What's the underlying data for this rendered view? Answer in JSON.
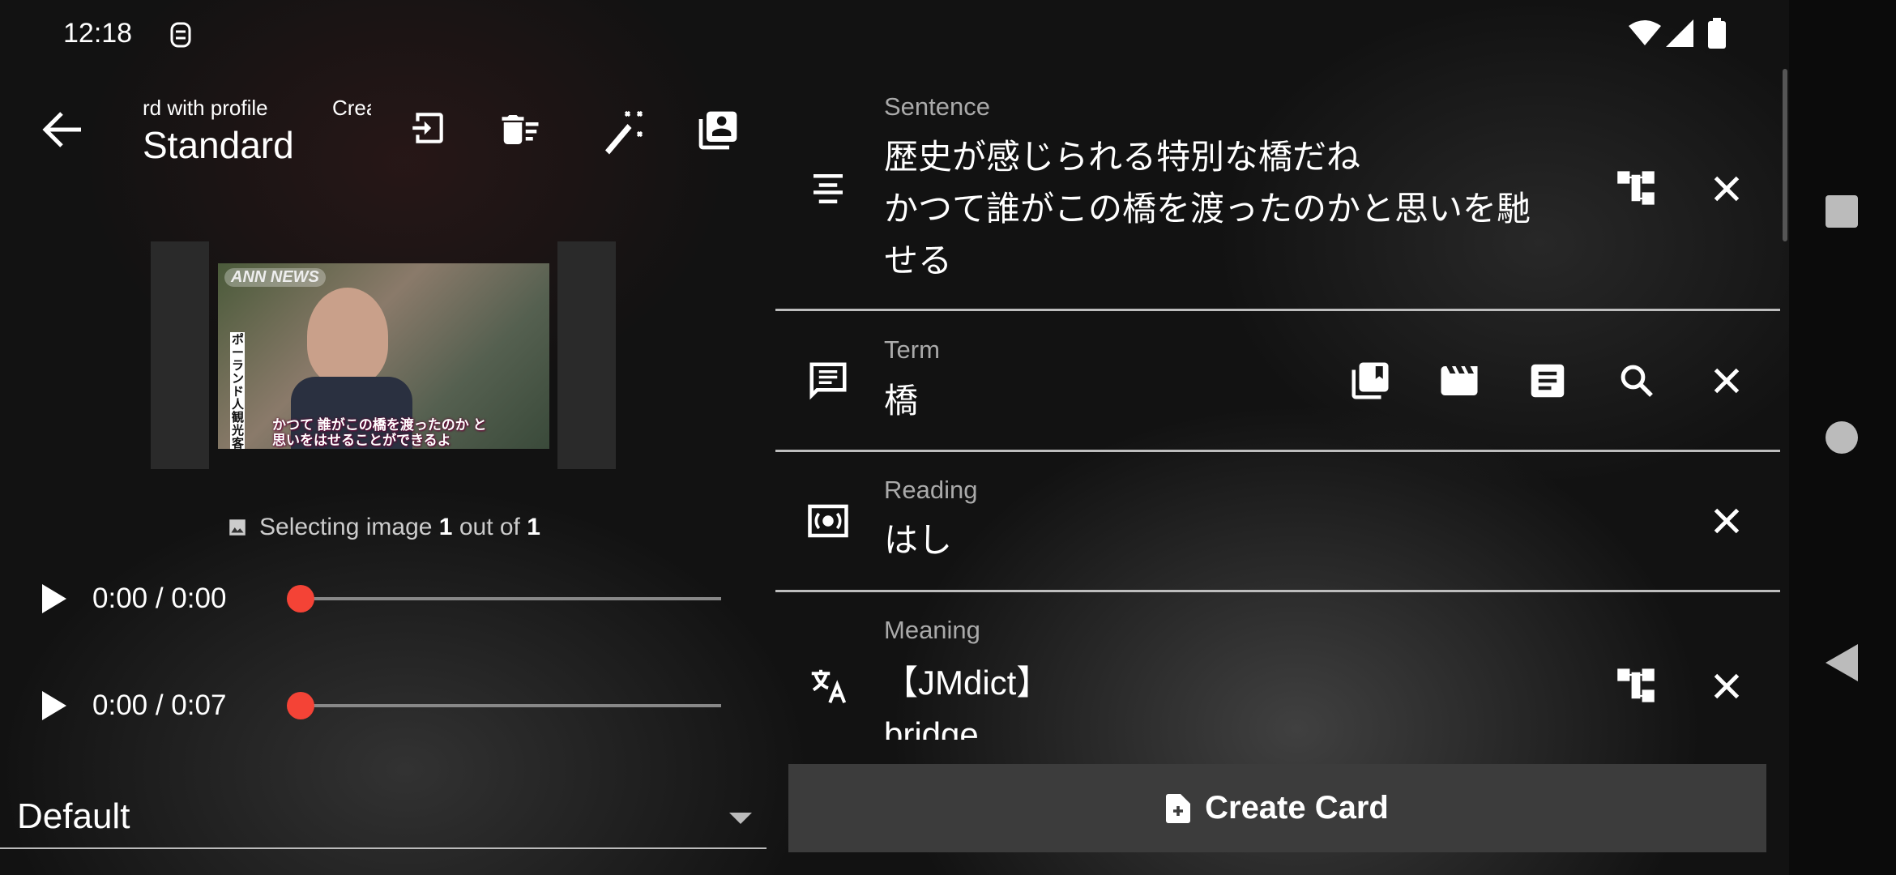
{
  "status_bar": {
    "time": "12:18",
    "icons": [
      "app-notification-icon",
      "wifi-icon",
      "signal-icon",
      "battery-icon"
    ]
  },
  "toolbar": {
    "subtitle": "rd with profile",
    "subtitle2": "Crea",
    "title": "Standard",
    "icons": [
      "back-arrow-icon",
      "export-icon",
      "clear-fields-icon",
      "auto-fill-wand-icon",
      "profile-icon"
    ]
  },
  "image_picker": {
    "caption_prefix": "Selecting image ",
    "current": "1",
    "caption_middle": " out of ",
    "total": "1",
    "watermark": "ANN NEWS",
    "subtitle_line1": "かつて 誰がこの橋を渡ったのか と",
    "subtitle_line2": "思いをはせることができるよ",
    "side_caption": "ポーランド人観光客"
  },
  "audio": [
    {
      "time": "0:00 / 0:00",
      "progress": 0
    },
    {
      "time": "0:00 / 0:07",
      "progress": 0
    }
  ],
  "dropdown": {
    "selected": "Default"
  },
  "fields": {
    "sentence": {
      "label": "Sentence",
      "lines": [
        "歴史が感じられる特別な橋だね",
        "かつて誰がこの橋を渡ったのかと思いを馳",
        "せる"
      ]
    },
    "term": {
      "label": "Term",
      "value": "橋"
    },
    "reading": {
      "label": "Reading",
      "value": "はし"
    },
    "meaning": {
      "label": "Meaning",
      "lines": [
        "【JMdict】",
        "bridge"
      ]
    }
  },
  "create_button": {
    "label": "Create Card"
  },
  "colors": {
    "accent": "#f44336",
    "button_bg": "#3c3c3c"
  }
}
